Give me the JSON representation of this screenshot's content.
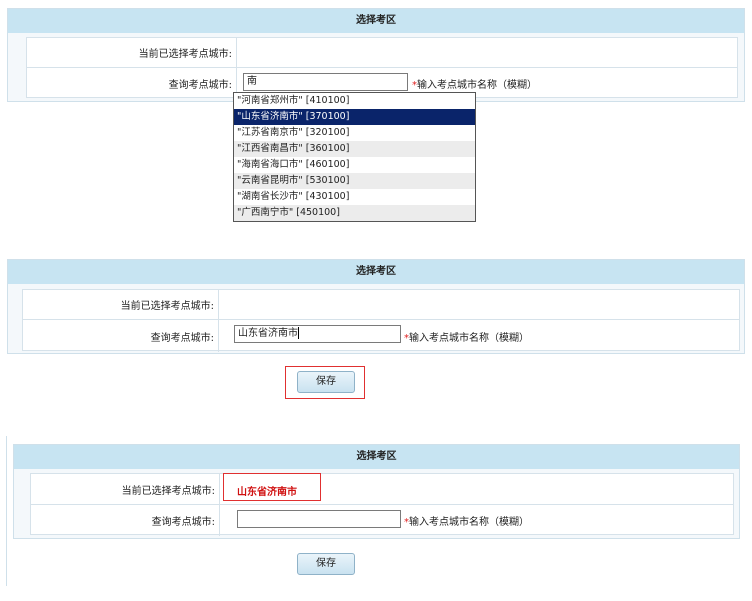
{
  "panel1": {
    "title": "选择考区",
    "current_label": "当前已选择考点城市:",
    "current_value": "",
    "query_label": "查询考点城市:",
    "query_value": "南",
    "hint": "输入考点城市名称（模糊）",
    "dropdown": [
      "\"河南省郑州市\" [410100]",
      "\"山东省济南市\" [370100]",
      "\"江苏省南京市\" [320100]",
      "\"江西省南昌市\" [360100]",
      "\"海南省海口市\" [460100]",
      "\"云南省昆明市\" [530100]",
      "\"湖南省长沙市\" [430100]",
      "\"广西南宁市\" [450100]"
    ]
  },
  "panel2": {
    "title": "选择考区",
    "current_label": "当前已选择考点城市:",
    "current_value": "",
    "query_label": "查询考点城市:",
    "query_value": "山东省济南市",
    "hint": "输入考点城市名称（模糊）",
    "save_label": "保存"
  },
  "panel3": {
    "title": "选择考区",
    "current_label": "当前已选择考点城市:",
    "current_value": "山东省济南市",
    "query_label": "查询考点城市:",
    "query_value": "",
    "hint": "输入考点城市名称（模糊）",
    "save_label": "保存"
  },
  "colors": {
    "header_bg": "#c7e4f2",
    "highlight_box": "#e03030",
    "dropdown_selected": "#0a246a",
    "required_star": "#e02020"
  }
}
